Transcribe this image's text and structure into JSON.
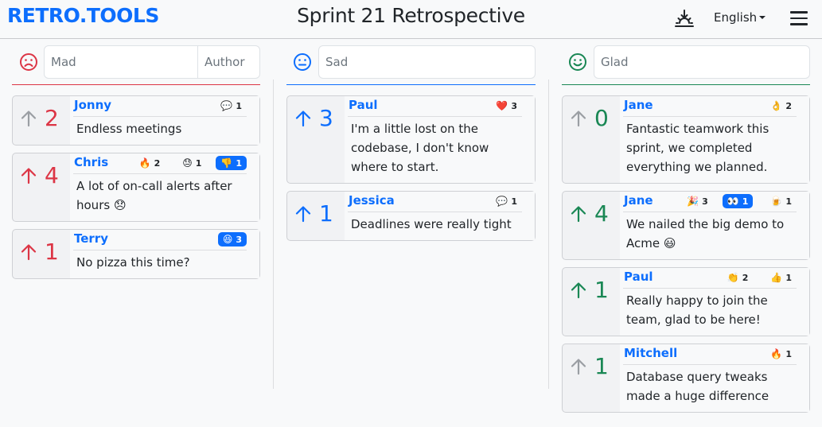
{
  "header": {
    "brand": "RETRO.TOOLS",
    "title": "Sprint 21 Retrospective",
    "theme_icon": "sunset-icon",
    "language": "English",
    "menu_icon": "hamburger-icon"
  },
  "columns": [
    {
      "name": "Mad",
      "icon": "frown-icon",
      "color": "#dc3545",
      "placeholder": "Mad",
      "author_placeholder": "Author",
      "cards": [
        {
          "author": "Jonny",
          "votes": "2",
          "voted": false,
          "text": "Endless meetings",
          "reactions": [
            {
              "emoji": "💬",
              "count": "1",
              "active": false
            }
          ]
        },
        {
          "author": "Chris",
          "votes": "4",
          "voted": true,
          "text": "A lot of on-call alerts after hours 😞",
          "reactions": [
            {
              "emoji": "🔥",
              "count": "2",
              "active": false
            },
            {
              "emoji": "😓",
              "count": "1",
              "active": false
            },
            {
              "emoji": "👎",
              "count": "1",
              "active": true
            }
          ]
        },
        {
          "author": "Terry",
          "votes": "1",
          "voted": true,
          "text": "No pizza this time?",
          "reactions": [
            {
              "emoji": "😆",
              "count": "3",
              "active": true
            }
          ]
        }
      ]
    },
    {
      "name": "Sad",
      "icon": "neutral-face-icon",
      "color": "#0d6efd",
      "placeholder": "Sad",
      "cards": [
        {
          "author": "Paul",
          "votes": "3",
          "voted": true,
          "text": "I'm a little lost on the codebase, I don't know where to start.",
          "reactions": [
            {
              "emoji": "❤️",
              "count": "3",
              "active": false
            }
          ]
        },
        {
          "author": "Jessica",
          "votes": "1",
          "voted": true,
          "text": "Deadlines were really tight",
          "reactions": [
            {
              "emoji": "💬",
              "count": "1",
              "active": false
            }
          ]
        }
      ]
    },
    {
      "name": "Glad",
      "icon": "smile-icon",
      "color": "#198754",
      "placeholder": "Glad",
      "cards": [
        {
          "author": "Jane",
          "votes": "0",
          "voted": false,
          "text": "Fantastic teamwork this sprint, we completed everything we planned.",
          "reactions": [
            {
              "emoji": "👌",
              "count": "2",
              "active": false
            }
          ]
        },
        {
          "author": "Jane",
          "votes": "4",
          "voted": true,
          "text": "We nailed the big demo to Acme 😃",
          "reactions": [
            {
              "emoji": "🎉",
              "count": "3",
              "active": false
            },
            {
              "emoji": "👀",
              "count": "1",
              "active": true
            },
            {
              "emoji": "🍺",
              "count": "1",
              "active": false
            }
          ]
        },
        {
          "author": "Paul",
          "votes": "1",
          "voted": true,
          "text": "Really happy to join the team, glad to be here!",
          "reactions": [
            {
              "emoji": "👏",
              "count": "2",
              "active": false
            },
            {
              "emoji": "👍",
              "count": "1",
              "active": false
            }
          ]
        },
        {
          "author": "Mitchell",
          "votes": "1",
          "voted": false,
          "text": "Database query tweaks made a huge difference",
          "reactions": [
            {
              "emoji": "🔥",
              "count": "1",
              "active": false
            }
          ]
        }
      ]
    }
  ]
}
